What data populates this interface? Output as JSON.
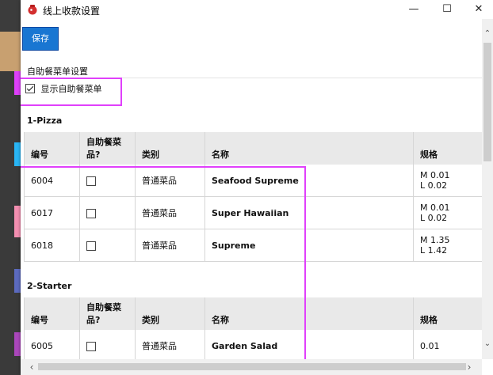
{
  "window": {
    "title": "线上收款设置"
  },
  "toolbar": {
    "save_label": "保存"
  },
  "self_service": {
    "heading": "自助餐菜单设置",
    "show_menu_label": "显示自助餐菜单",
    "show_menu_checked": true
  },
  "columns": [
    "编号",
    "自助餐菜品?",
    "类别",
    "名称",
    "规格"
  ],
  "groups": [
    {
      "title": "1-Pizza",
      "rows": [
        {
          "id": "6004",
          "buffet": false,
          "category": "普通菜品",
          "name": "Seafood Supreme",
          "spec": [
            "M 0.01",
            "L 0.02"
          ]
        },
        {
          "id": "6017",
          "buffet": false,
          "category": "普通菜品",
          "name": "Super Hawaiian",
          "spec": [
            "M 0.01",
            "L 0.02"
          ]
        },
        {
          "id": "6018",
          "buffet": false,
          "category": "普通菜品",
          "name": "Supreme",
          "spec": [
            "M 1.35",
            "L 1.42"
          ]
        }
      ]
    },
    {
      "title": "2-Starter",
      "rows": [
        {
          "id": "6005",
          "buffet": false,
          "category": "普通菜品",
          "name": "Garden Salad",
          "spec": [
            "0.01"
          ]
        }
      ]
    }
  ],
  "colors": {
    "accent": "#1976d2",
    "annotation": "#e040fb",
    "header_bg": "#e9e9e9"
  },
  "icons": {
    "app": "app-icon",
    "minimize": "minimize-icon",
    "maximize": "maximize-icon",
    "close": "close-icon"
  }
}
